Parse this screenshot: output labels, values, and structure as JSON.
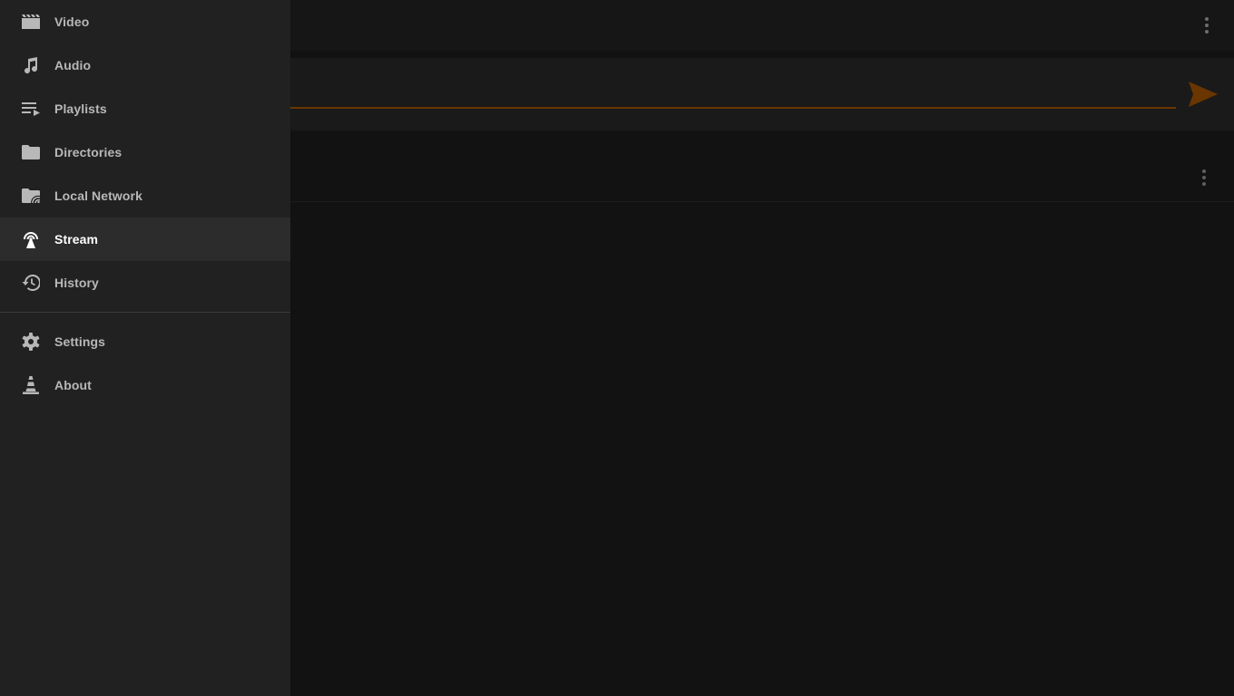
{
  "drawer": {
    "items": [
      {
        "label": "Video",
        "icon": "movie-icon"
      },
      {
        "label": "Audio",
        "icon": "music-note-icon"
      },
      {
        "label": "Playlists",
        "icon": "playlist-icon"
      },
      {
        "label": "Directories",
        "icon": "folder-icon"
      },
      {
        "label": "Local Network",
        "icon": "network-folder-icon"
      },
      {
        "label": "Stream",
        "icon": "antenna-icon",
        "active": true
      },
      {
        "label": "History",
        "icon": "history-icon"
      }
    ],
    "secondary": [
      {
        "label": "Settings",
        "icon": "gear-icon"
      },
      {
        "label": "About",
        "icon": "vlc-cone-icon"
      }
    ]
  },
  "stream": {
    "input_value": "",
    "input_placeholder": ""
  },
  "colors": {
    "accent": "#6a3600",
    "drawer_bg": "#212121",
    "active_item_bg": "#2c2c2c",
    "content_bg": "#121212"
  }
}
